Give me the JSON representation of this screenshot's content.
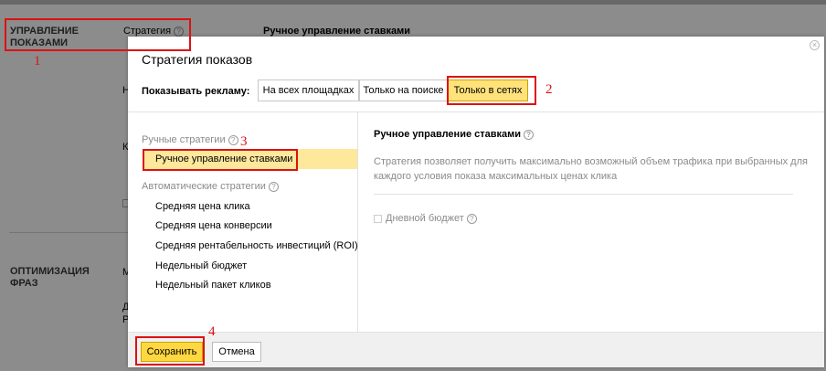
{
  "background": {
    "section1_title": "УПРАВЛЕНИЕ ПОКАЗАМИ",
    "strategy_label": "Стратегия",
    "strategy_value": "Ручное управление ставками",
    "section2_title": "ОПТИМИЗАЦИЯ ФРАЗ",
    "stubs": [
      "Н",
      "К",
      "М",
      "Д",
      "Р"
    ]
  },
  "modal": {
    "title": "Стратегия показов",
    "show_ads_label": "Показывать рекламу:",
    "segments": [
      "На всех площадках",
      "Только на поиске",
      "Только в сетях"
    ],
    "active_segment": "Только в сетях",
    "manual_group": "Ручные стратегии",
    "manual_items": [
      "Ручное управление ставками"
    ],
    "auto_group": "Автоматические стратегии",
    "auto_items": [
      "Средняя цена клика",
      "Средняя цена конверсии",
      "Средняя рентабельность инвестиций (ROI)",
      "Недельный бюджет",
      "Недельный пакет кликов"
    ],
    "detail_title": "Ручное управление ставками",
    "detail_desc": "Стратегия позволяет получить максимально возможный объем трафика при выбранных для каждого условия показа максимальных ценах клика",
    "daily_budget_label": "Дневной бюджет",
    "save_label": "Сохранить",
    "cancel_label": "Отмена",
    "close_icon": "close-icon",
    "help_icon": "help-icon"
  },
  "annotations": [
    "1",
    "2",
    "3",
    "4"
  ],
  "colors": {
    "accent_yellow": "#ffd740",
    "selected_bg": "#fde89c",
    "annotation_red": "#dd1111"
  }
}
